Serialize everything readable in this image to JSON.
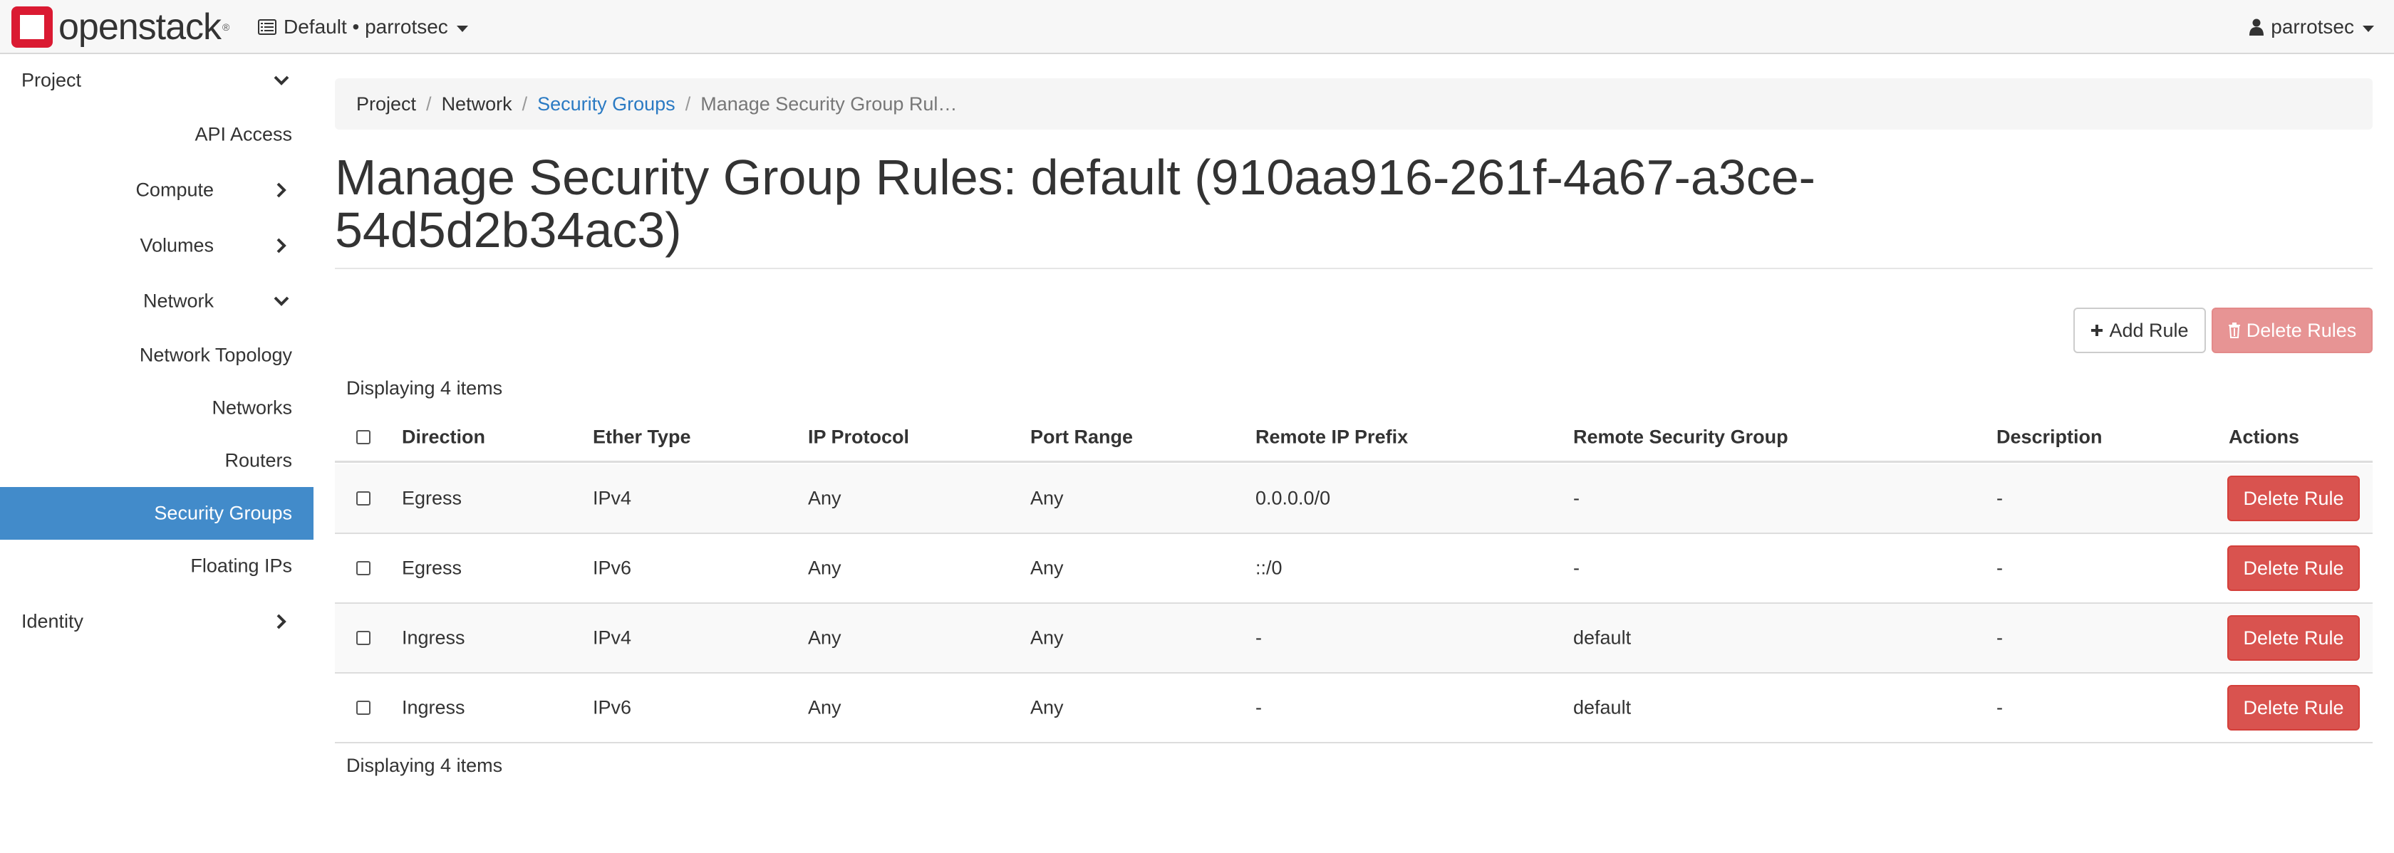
{
  "brand": {
    "name": "openstack",
    "trademark": "®",
    "logo_color": "#da1a32"
  },
  "header": {
    "project_selector": "Default • parrotsec",
    "user": "parrotsec"
  },
  "sidebar": {
    "project": "Project",
    "api_access": "API Access",
    "compute": "Compute",
    "volumes": "Volumes",
    "network": "Network",
    "network_topology": "Network Topology",
    "networks": "Networks",
    "routers": "Routers",
    "security_groups": "Security Groups",
    "floating_ips": "Floating IPs",
    "identity": "Identity",
    "active_color": "#428bca"
  },
  "breadcrumb": {
    "items": [
      "Project",
      "Network",
      "Security Groups",
      "Manage Security Group Rul…"
    ],
    "separator": "/"
  },
  "page": {
    "title": "Manage Security Group Rules: default (910aa916-261f-4a67-a3ce-54d5d2b34ac3)"
  },
  "actions": {
    "add_rule": "Add Rule",
    "add_icon": "plus-icon",
    "delete_rules": "Delete Rules",
    "delete_icon": "trash-icon"
  },
  "table": {
    "displaying_top": "Displaying 4 items",
    "displaying_bottom": "Displaying 4 items",
    "columns": [
      "Direction",
      "Ether Type",
      "IP Protocol",
      "Port Range",
      "Remote IP Prefix",
      "Remote Security Group",
      "Description",
      "Actions"
    ],
    "rows": [
      {
        "direction": "Egress",
        "ether_type": "IPv4",
        "ip_protocol": "Any",
        "port_range": "Any",
        "remote_ip_prefix": "0.0.0.0/0",
        "remote_security_group": "-",
        "description": "-",
        "action": "Delete Rule"
      },
      {
        "direction": "Egress",
        "ether_type": "IPv6",
        "ip_protocol": "Any",
        "port_range": "Any",
        "remote_ip_prefix": "::/0",
        "remote_security_group": "-",
        "description": "-",
        "action": "Delete Rule"
      },
      {
        "direction": "Ingress",
        "ether_type": "IPv4",
        "ip_protocol": "Any",
        "port_range": "Any",
        "remote_ip_prefix": "-",
        "remote_security_group": "default",
        "description": "-",
        "action": "Delete Rule"
      },
      {
        "direction": "Ingress",
        "ether_type": "IPv6",
        "ip_protocol": "Any",
        "port_range": "Any",
        "remote_ip_prefix": "-",
        "remote_security_group": "default",
        "description": "-",
        "action": "Delete Rule"
      }
    ],
    "danger_color": "#d9534f"
  }
}
